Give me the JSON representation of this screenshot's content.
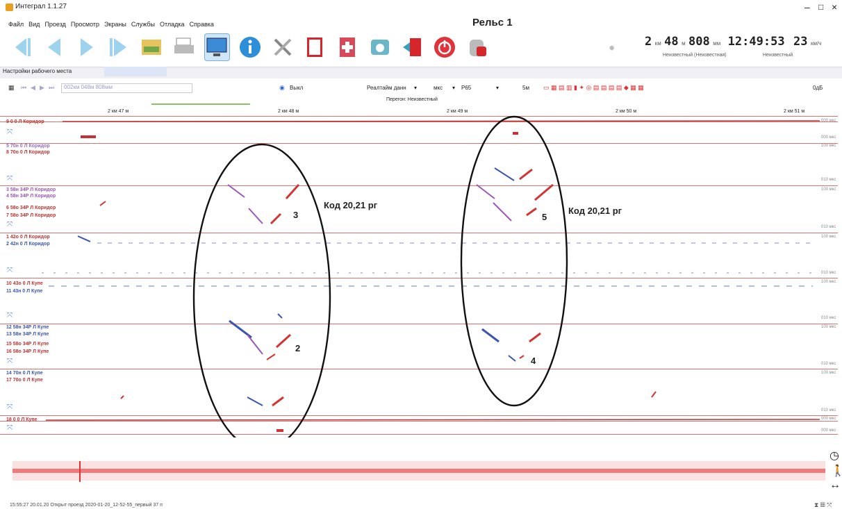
{
  "window": {
    "title": "Интеграл 1.1.27",
    "minimize": "–",
    "maximize": "□",
    "close": "×"
  },
  "menu": [
    "Файл",
    "Вид",
    "Проезд",
    "Просмотр",
    "Экраны",
    "Службы",
    "Отладка",
    "Справка"
  ],
  "doc_title": "Рельс 1",
  "toolbar_icons": [
    "first-icon",
    "prev-icon",
    "next-icon",
    "last-icon",
    "ruler-folder-icon",
    "print-icon",
    "monitor-icon",
    "info-icon",
    "tools-icon",
    "book-icon",
    "add-book-icon",
    "camera-icon",
    "exit-icon",
    "power-icon",
    "database-icon"
  ],
  "readout": {
    "km_value": "2",
    "km_unit": "км",
    "m_value": "48",
    "m_unit": "м",
    "mm_value": "808",
    "mm_unit": "мм",
    "time": "12:49:53",
    "speed_value": "23",
    "speed_unit": "км/ч",
    "sub_left": "Неизвестный (Неизвестная)",
    "sub_right": "Неизвестный"
  },
  "tabs": {
    "active": "Настройки рабочего места"
  },
  "toolbar2": {
    "position_placeholder": "002км 048м 808мм",
    "off_label": "Выкл",
    "realtime_label": "Реалтайм данн",
    "unit_label": "мкс",
    "rail_type": "Р65",
    "five_m": "5м",
    "zoom": "0дБ"
  },
  "peregon": "Перегон: Неизвестный",
  "ruler_labels": [
    "2 км 47 м",
    "2 км 48 м",
    "2 км 49 м",
    "2 км 50 м",
    "2 км 51 м"
  ],
  "channels": [
    {
      "labels": [
        "9 0 0 Л Коридор"
      ],
      "scale_top": "000 мкс",
      "scale_bot": "000 мкс"
    },
    {
      "labels": [
        "5 70н 0 Л Коридор",
        "8 70о 0 Л Коридор"
      ],
      "scale_top": "100 мкс",
      "scale_bot": "010 мкс"
    },
    {
      "labels": [
        "3 58н 34Р Л Коридор",
        "4 58н 34Р Л Коридор",
        "6 58о 34Р Л Коридор",
        "7 58о 34Р Л Коридор"
      ],
      "scale_top": "100 мкс",
      "scale_bot": "010 мкс"
    },
    {
      "labels": [
        "1 42о 0 Л Коридор",
        "2 42н 0 Л Коридор"
      ],
      "scale_top": "100 мкс",
      "scale_bot": "010 мкс"
    },
    {
      "labels": [
        "10 43о 0 Л Купе",
        "11 43н 0 Л Купе"
      ],
      "scale_top": "100 мкс",
      "scale_bot": "010 мкс"
    },
    {
      "labels": [
        "12 58н 34Р Л Купе",
        "13 58н 34Р Л Купе",
        "15 58о 34Р Л Купе",
        "16 58о 34Р Л Купе"
      ],
      "scale_top": "100 мкс",
      "scale_bot": "010 мкс"
    },
    {
      "labels": [
        "14 70н 0 Л Купе",
        "17 70о 0 Л Купе"
      ],
      "scale_top": "100 мкс",
      "scale_bot": "010 мкс"
    },
    {
      "labels": [
        "18 0 0 Л Купе"
      ],
      "scale_top": "000 мкс",
      "scale_bot": "000 мкс"
    }
  ],
  "annotations": {
    "code_left": "Код 20,21 рг",
    "code_right": "Код 20,21 рг",
    "n3": "3",
    "n2": "2",
    "n5": "5",
    "n4": "4"
  },
  "status": "15:55:27 20.01.20 Открыт проезд 2020-01-20_12-52-55_первый 37 п",
  "colors": {
    "accent": "#d33333",
    "blue": "#3a55b0",
    "purple": "#9a56b8",
    "track": "#f07a7a"
  }
}
